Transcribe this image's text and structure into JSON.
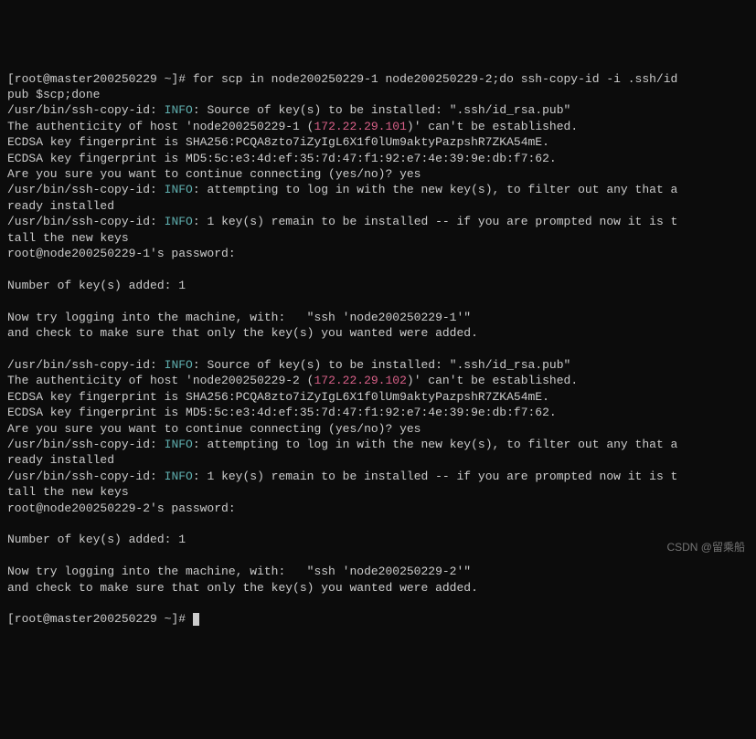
{
  "prompt_partial_top": "[root@master200250229 ~]# ",
  "cmd": "for scp in node200250229-1 node200250229-2;do ssh-copy-id -i .ssh/id",
  "cmd_cont": "pub $scp;done",
  "sshbin": "/usr/bin/ssh-copy-id: ",
  "info": "INFO",
  "src_keys": ": Source of key(s) to be installed: \".ssh/id_rsa.pub\"",
  "auth_pre_1": "The authenticity of host 'node200250229-1 (",
  "ip1": "172.22.29.101",
  "auth_post": ")' can't be established.",
  "fp_sha": "ECDSA key fingerprint is SHA256:PCQA8zto7iZyIgL6X1f0lUm9aktyPazpshR7ZKA54mE.",
  "fp_md5": "ECDSA key fingerprint is MD5:5c:e3:4d:ef:35:7d:47:f1:92:e7:4e:39:9e:db:f7:62.",
  "confirm": "Are you sure you want to continue connecting (yes/no)? yes",
  "attempt": ": attempting to log in with the new key(s), to filter out any that a",
  "ready": "ready installed",
  "remain": ": 1 key(s) remain to be installed -- if you are prompted now it is t",
  "tall": "tall the new keys",
  "pass1": "root@node200250229-1's password:",
  "added": "Number of key(s) added: 1",
  "trylog1": "Now try logging into the machine, with:   \"ssh 'node200250229-1'\"",
  "check": "and check to make sure that only the key(s) you wanted were added.",
  "auth_pre_2": "The authenticity of host 'node200250229-2 (",
  "ip2": "172.22.29.102",
  "pass2": "root@node200250229-2's password:",
  "trylog2": "Now try logging into the machine, with:   \"ssh 'node200250229-2'\"",
  "final_prompt": "[root@master200250229 ~]# ",
  "watermark": "CSDN @留乘船"
}
